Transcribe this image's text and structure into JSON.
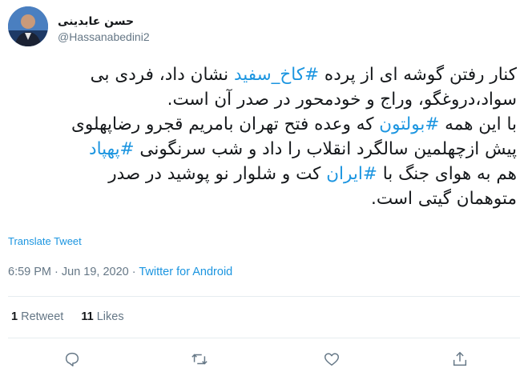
{
  "author": {
    "display_name": "حسن عابدینی",
    "handle": "@Hassanabedini2"
  },
  "tweet": {
    "lines": [
      [
        {
          "text": "کنار رفتن گوشه ای از پرده ",
          "hashtag": false
        },
        {
          "text": "#کاخ_سفید",
          "hashtag": true
        },
        {
          "text": " نشان داد، فردی بی",
          "hashtag": false
        }
      ],
      [
        {
          "text": "سواد،دروغگو، وراج و خودمحور در صدر آن است.",
          "hashtag": false
        }
      ],
      [
        {
          "text": "با این همه ",
          "hashtag": false
        },
        {
          "text": "#بولتون",
          "hashtag": true
        },
        {
          "text": " که وعده فتح تهران بامریم قجرو رضاپهلوی",
          "hashtag": false
        }
      ],
      [
        {
          "text": "پیش ازچهلمین سالگرد انقلاب را داد و شب سرنگونی ",
          "hashtag": false
        },
        {
          "text": "#پهپاد",
          "hashtag": true
        }
      ],
      [
        {
          "text": "هم به هوای جنگ با ",
          "hashtag": false
        },
        {
          "text": "#ایران",
          "hashtag": true
        },
        {
          "text": " کت و شلوار نو پوشید در صدر",
          "hashtag": false
        }
      ],
      [
        {
          "text": "متوهمان گیتی است.",
          "hashtag": false
        }
      ]
    ],
    "translate_label": "Translate Tweet"
  },
  "meta": {
    "time": "6:59 PM",
    "separator": " · ",
    "date": "Jun 19, 2020",
    "source": "Twitter for Android"
  },
  "stats": {
    "retweets_count": "1",
    "retweets_label": " Retweet",
    "likes_count": "11",
    "likes_label": " Likes"
  },
  "actions": {
    "icons": [
      "reply-icon",
      "retweet-icon",
      "like-icon",
      "share-icon"
    ]
  },
  "colors": {
    "link": "#1b95e0",
    "secondary_text": "#657786",
    "primary_text": "#14171a",
    "divider": "#e6ecf0"
  }
}
